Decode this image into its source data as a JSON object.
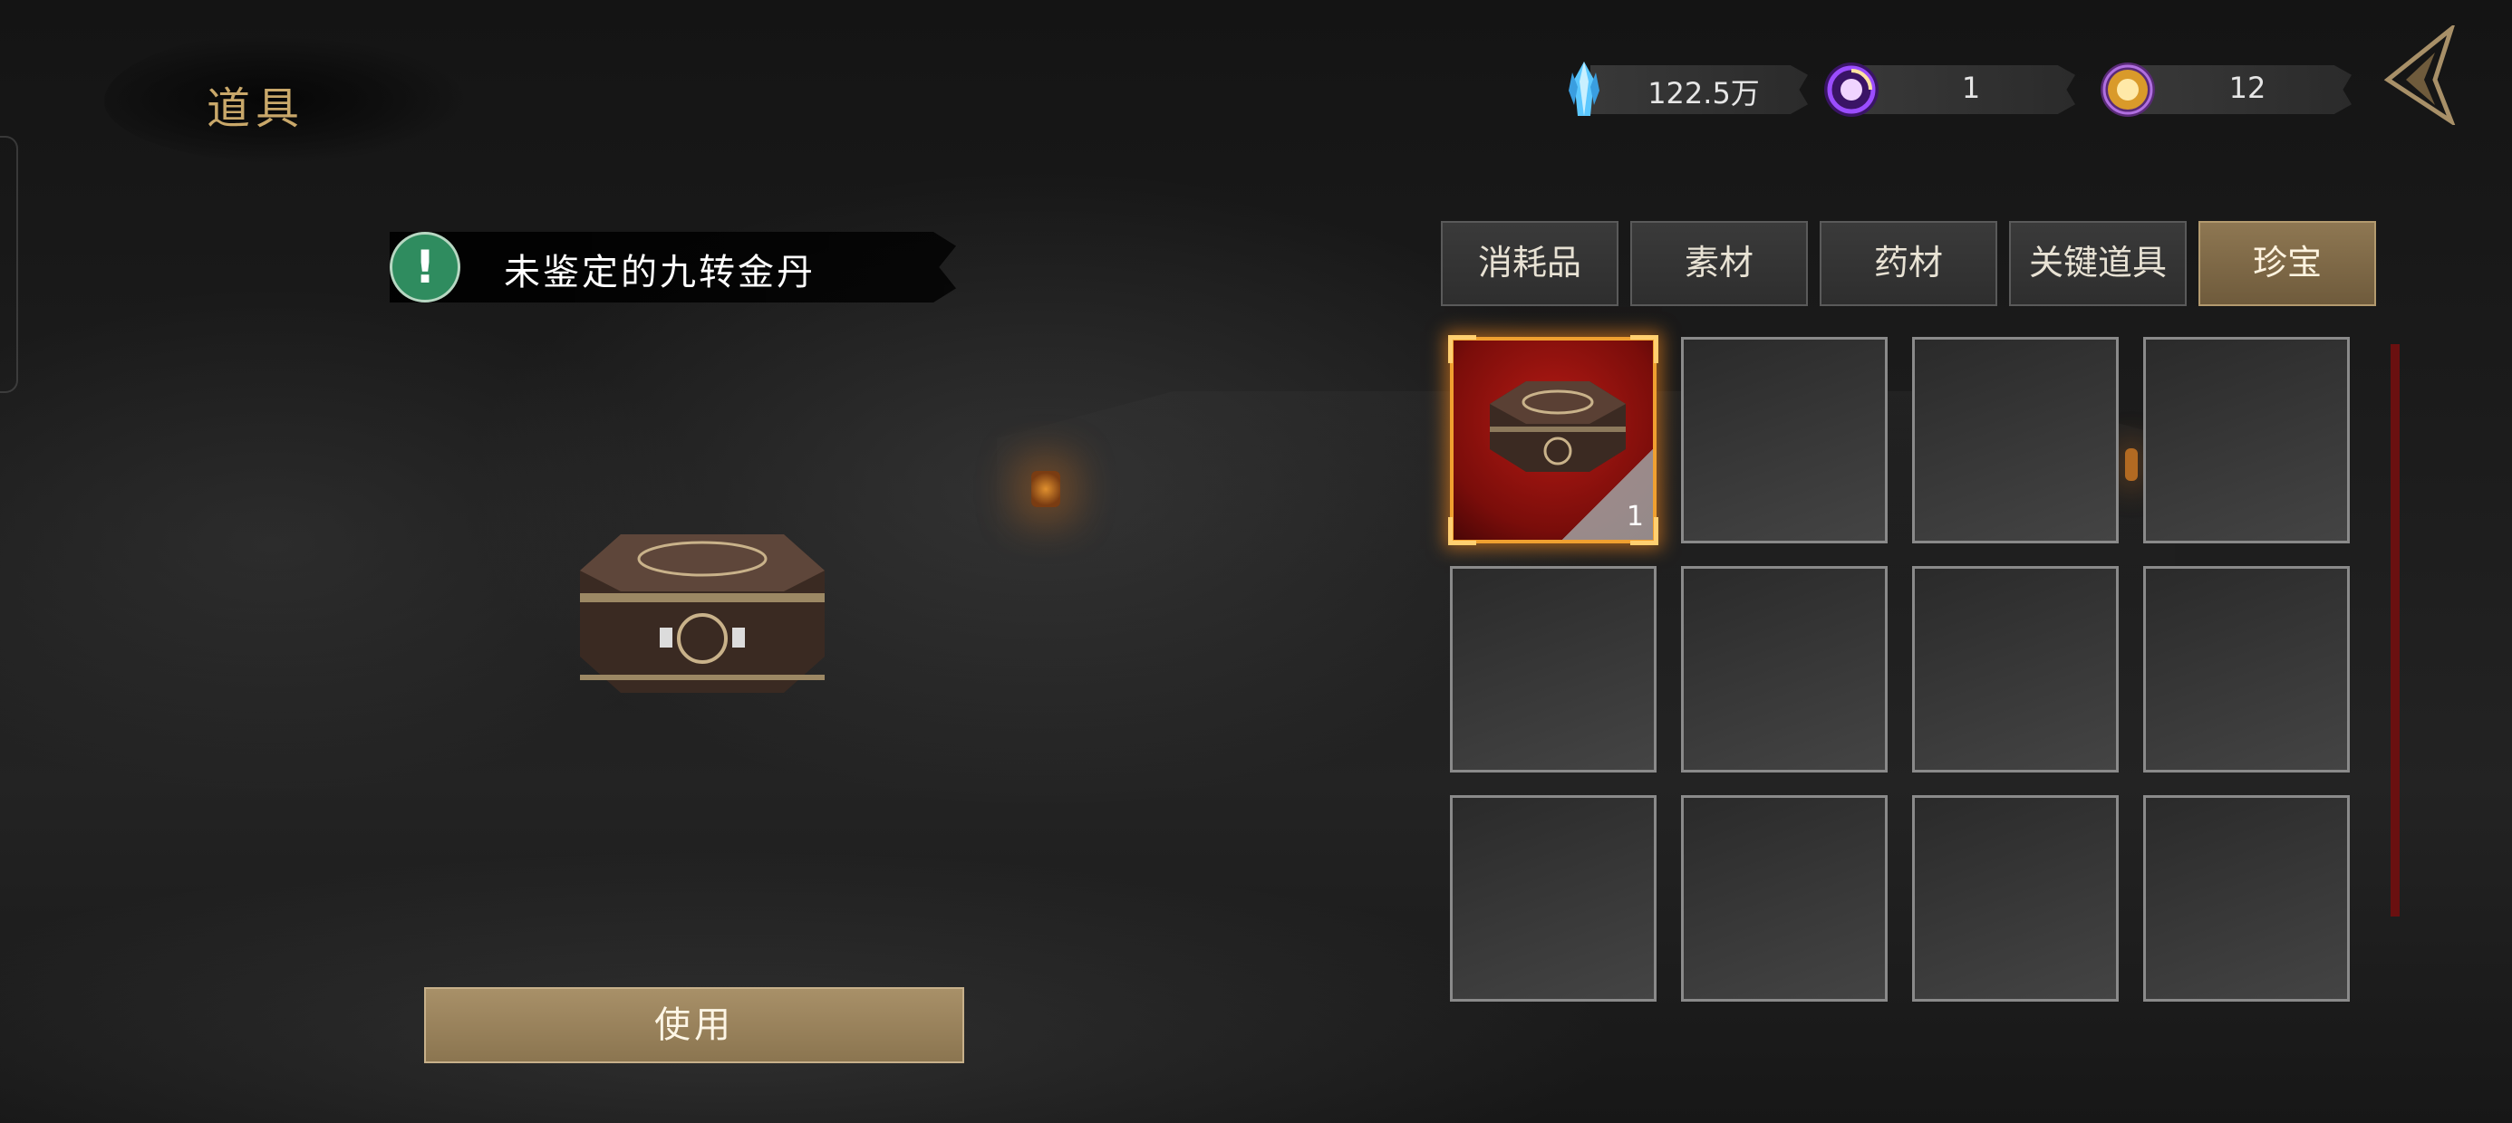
{
  "header": {
    "title": "道具"
  },
  "currencies": [
    {
      "name": "crystal-icon",
      "value": "122.5万",
      "color": "#5cc8ff"
    },
    {
      "name": "purple-orb-icon",
      "value": "1",
      "color": "#9b4dff"
    },
    {
      "name": "gold-orb-icon",
      "value": "12",
      "color": "#ffbf3a"
    }
  ],
  "tabs": [
    {
      "label": "消耗品",
      "active": false
    },
    {
      "label": "素材",
      "active": false
    },
    {
      "label": "药材",
      "active": false
    },
    {
      "label": "关键道具",
      "active": false
    },
    {
      "label": "珍宝",
      "active": true
    }
  ],
  "selected_item": {
    "name": "未鉴定的九转金丹",
    "badge_icon": "exclamation-icon"
  },
  "slots": [
    {
      "item": "hexagonal-chest-icon",
      "count": "1",
      "selected": true
    },
    {
      "item": null
    },
    {
      "item": null
    },
    {
      "item": null
    },
    {
      "item": null
    },
    {
      "item": null
    },
    {
      "item": null
    },
    {
      "item": null
    },
    {
      "item": null
    },
    {
      "item": null
    },
    {
      "item": null
    },
    {
      "item": null
    }
  ],
  "actions": {
    "use_label": "使用"
  },
  "colors": {
    "accent": "#8e7752",
    "selected_slot": "#b51a14",
    "scrollbar": "#6a1010"
  }
}
